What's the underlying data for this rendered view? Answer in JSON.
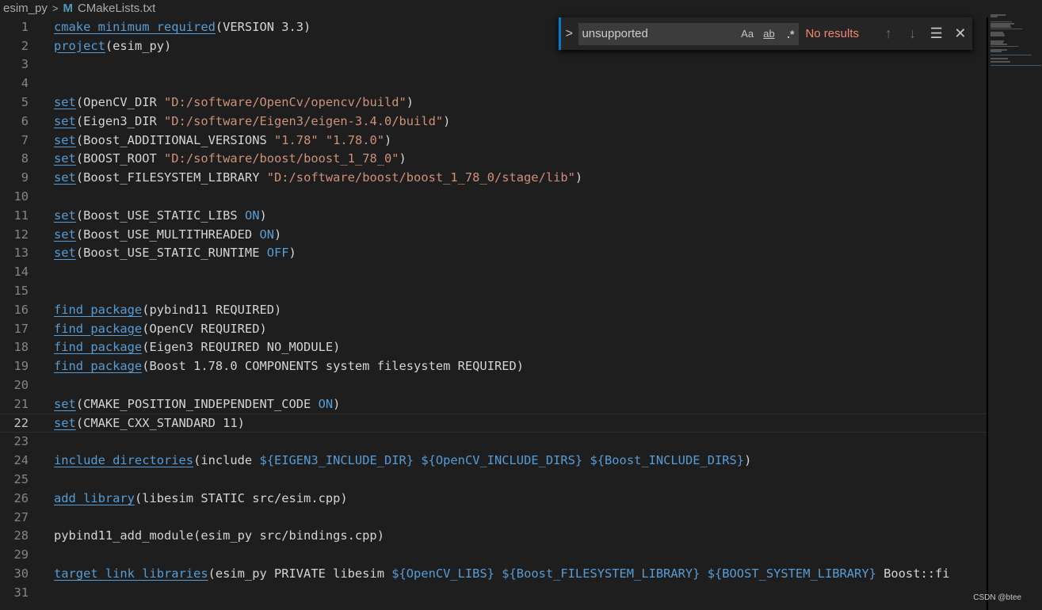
{
  "breadcrumb": {
    "folder": "esim_py",
    "separator": ">",
    "file_icon": "M",
    "file": "CMakeLists.txt"
  },
  "find": {
    "query": "unsupported",
    "match_case_label": "Aa",
    "whole_word_label": "ab",
    "regex_label": ".*",
    "result": "No results",
    "prev_icon": "↑",
    "next_icon": "↓",
    "selection_icon": "☰",
    "close_icon": "✕",
    "expand_icon": ">"
  },
  "current_line": 22,
  "lines": [
    {
      "n": "1",
      "t": [
        [
          "f",
          "cmake_minimum_required"
        ],
        [
          "p",
          "(VERSION 3.3)"
        ]
      ]
    },
    {
      "n": "2",
      "t": [
        [
          "f",
          "project"
        ],
        [
          "p",
          "(esim_py)"
        ]
      ]
    },
    {
      "n": "3",
      "t": []
    },
    {
      "n": "4",
      "t": []
    },
    {
      "n": "5",
      "t": [
        [
          "f",
          "set"
        ],
        [
          "p",
          "(OpenCV_DIR "
        ],
        [
          "s",
          "\"D:/software/OpenCv/opencv/build\""
        ],
        [
          "p",
          ")"
        ]
      ]
    },
    {
      "n": "6",
      "t": [
        [
          "f",
          "set"
        ],
        [
          "p",
          "(Eigen3_DIR "
        ],
        [
          "s",
          "\"D:/software/Eigen3/eigen-3.4.0/build\""
        ],
        [
          "p",
          ")"
        ]
      ]
    },
    {
      "n": "7",
      "t": [
        [
          "f",
          "set"
        ],
        [
          "p",
          "(Boost_ADDITIONAL_VERSIONS "
        ],
        [
          "s",
          "\"1.78\""
        ],
        [
          "p",
          " "
        ],
        [
          "s",
          "\"1.78.0\""
        ],
        [
          "p",
          ")"
        ]
      ]
    },
    {
      "n": "8",
      "t": [
        [
          "f",
          "set"
        ],
        [
          "p",
          "(BOOST_ROOT "
        ],
        [
          "s",
          "\"D:/software/boost/boost_1_78_0\""
        ],
        [
          "p",
          ")"
        ]
      ]
    },
    {
      "n": "9",
      "t": [
        [
          "f",
          "set"
        ],
        [
          "p",
          "(Boost_FILESYSTEM_LIBRARY "
        ],
        [
          "s",
          "\"D:/software/boost/boost_1_78_0/stage/lib\""
        ],
        [
          "p",
          ")"
        ]
      ]
    },
    {
      "n": "10",
      "t": []
    },
    {
      "n": "11",
      "t": [
        [
          "f",
          "set"
        ],
        [
          "p",
          "(Boost_USE_STATIC_LIBS "
        ],
        [
          "c",
          "ON"
        ],
        [
          "p",
          ")"
        ]
      ]
    },
    {
      "n": "12",
      "t": [
        [
          "f",
          "set"
        ],
        [
          "p",
          "(Boost_USE_MULTITHREADED "
        ],
        [
          "c",
          "ON"
        ],
        [
          "p",
          ")"
        ]
      ]
    },
    {
      "n": "13",
      "t": [
        [
          "f",
          "set"
        ],
        [
          "p",
          "(Boost_USE_STATIC_RUNTIME "
        ],
        [
          "c",
          "OFF"
        ],
        [
          "p",
          ")"
        ]
      ]
    },
    {
      "n": "14",
      "t": []
    },
    {
      "n": "15",
      "t": []
    },
    {
      "n": "16",
      "t": [
        [
          "f",
          "find_package"
        ],
        [
          "p",
          "(pybind11 REQUIRED)"
        ]
      ]
    },
    {
      "n": "17",
      "t": [
        [
          "f",
          "find_package"
        ],
        [
          "p",
          "(OpenCV REQUIRED)"
        ]
      ]
    },
    {
      "n": "18",
      "t": [
        [
          "f",
          "find_package"
        ],
        [
          "p",
          "(Eigen3 REQUIRED NO_MODULE)"
        ]
      ]
    },
    {
      "n": "19",
      "t": [
        [
          "f",
          "find_package"
        ],
        [
          "p",
          "(Boost 1.78.0 COMPONENTS system filesystem REQUIRED)"
        ]
      ]
    },
    {
      "n": "20",
      "t": []
    },
    {
      "n": "21",
      "t": [
        [
          "f",
          "set"
        ],
        [
          "p",
          "(CMAKE_POSITION_INDEPENDENT_CODE "
        ],
        [
          "c",
          "ON"
        ],
        [
          "p",
          ")"
        ]
      ]
    },
    {
      "n": "22",
      "t": [
        [
          "f",
          "set"
        ],
        [
          "p",
          "(CMAKE_CXX_STANDARD 11)"
        ]
      ]
    },
    {
      "n": "23",
      "t": []
    },
    {
      "n": "24",
      "t": [
        [
          "f",
          "include_directories"
        ],
        [
          "p",
          "(include "
        ],
        [
          "v",
          "${EIGEN3_INCLUDE_DIR}"
        ],
        [
          "p",
          " "
        ],
        [
          "v",
          "${OpenCV_INCLUDE_DIRS}"
        ],
        [
          "p",
          " "
        ],
        [
          "v",
          "${Boost_INCLUDE_DIRS}"
        ],
        [
          "p",
          ")"
        ]
      ]
    },
    {
      "n": "25",
      "t": []
    },
    {
      "n": "26",
      "t": [
        [
          "f",
          "add_library"
        ],
        [
          "p",
          "(libesim STATIC src/esim.cpp)"
        ]
      ]
    },
    {
      "n": "27",
      "t": []
    },
    {
      "n": "28",
      "t": [
        [
          "p",
          "pybind11_add_module(esim_py src/bindings.cpp)"
        ]
      ]
    },
    {
      "n": "29",
      "t": []
    },
    {
      "n": "30",
      "t": [
        [
          "f",
          "target_link_libraries"
        ],
        [
          "p",
          "(esim_py PRIVATE libesim "
        ],
        [
          "v",
          "${OpenCV_LIBS}"
        ],
        [
          "p",
          " "
        ],
        [
          "v",
          "${Boost_FILESYSTEM_LIBRARY}"
        ],
        [
          "p",
          " "
        ],
        [
          "v",
          "${BOOST_SYSTEM_LIBRARY}"
        ],
        [
          "p",
          " Boost::fi"
        ]
      ]
    },
    {
      "n": "31",
      "t": []
    }
  ],
  "watermark": "CSDN @btee"
}
